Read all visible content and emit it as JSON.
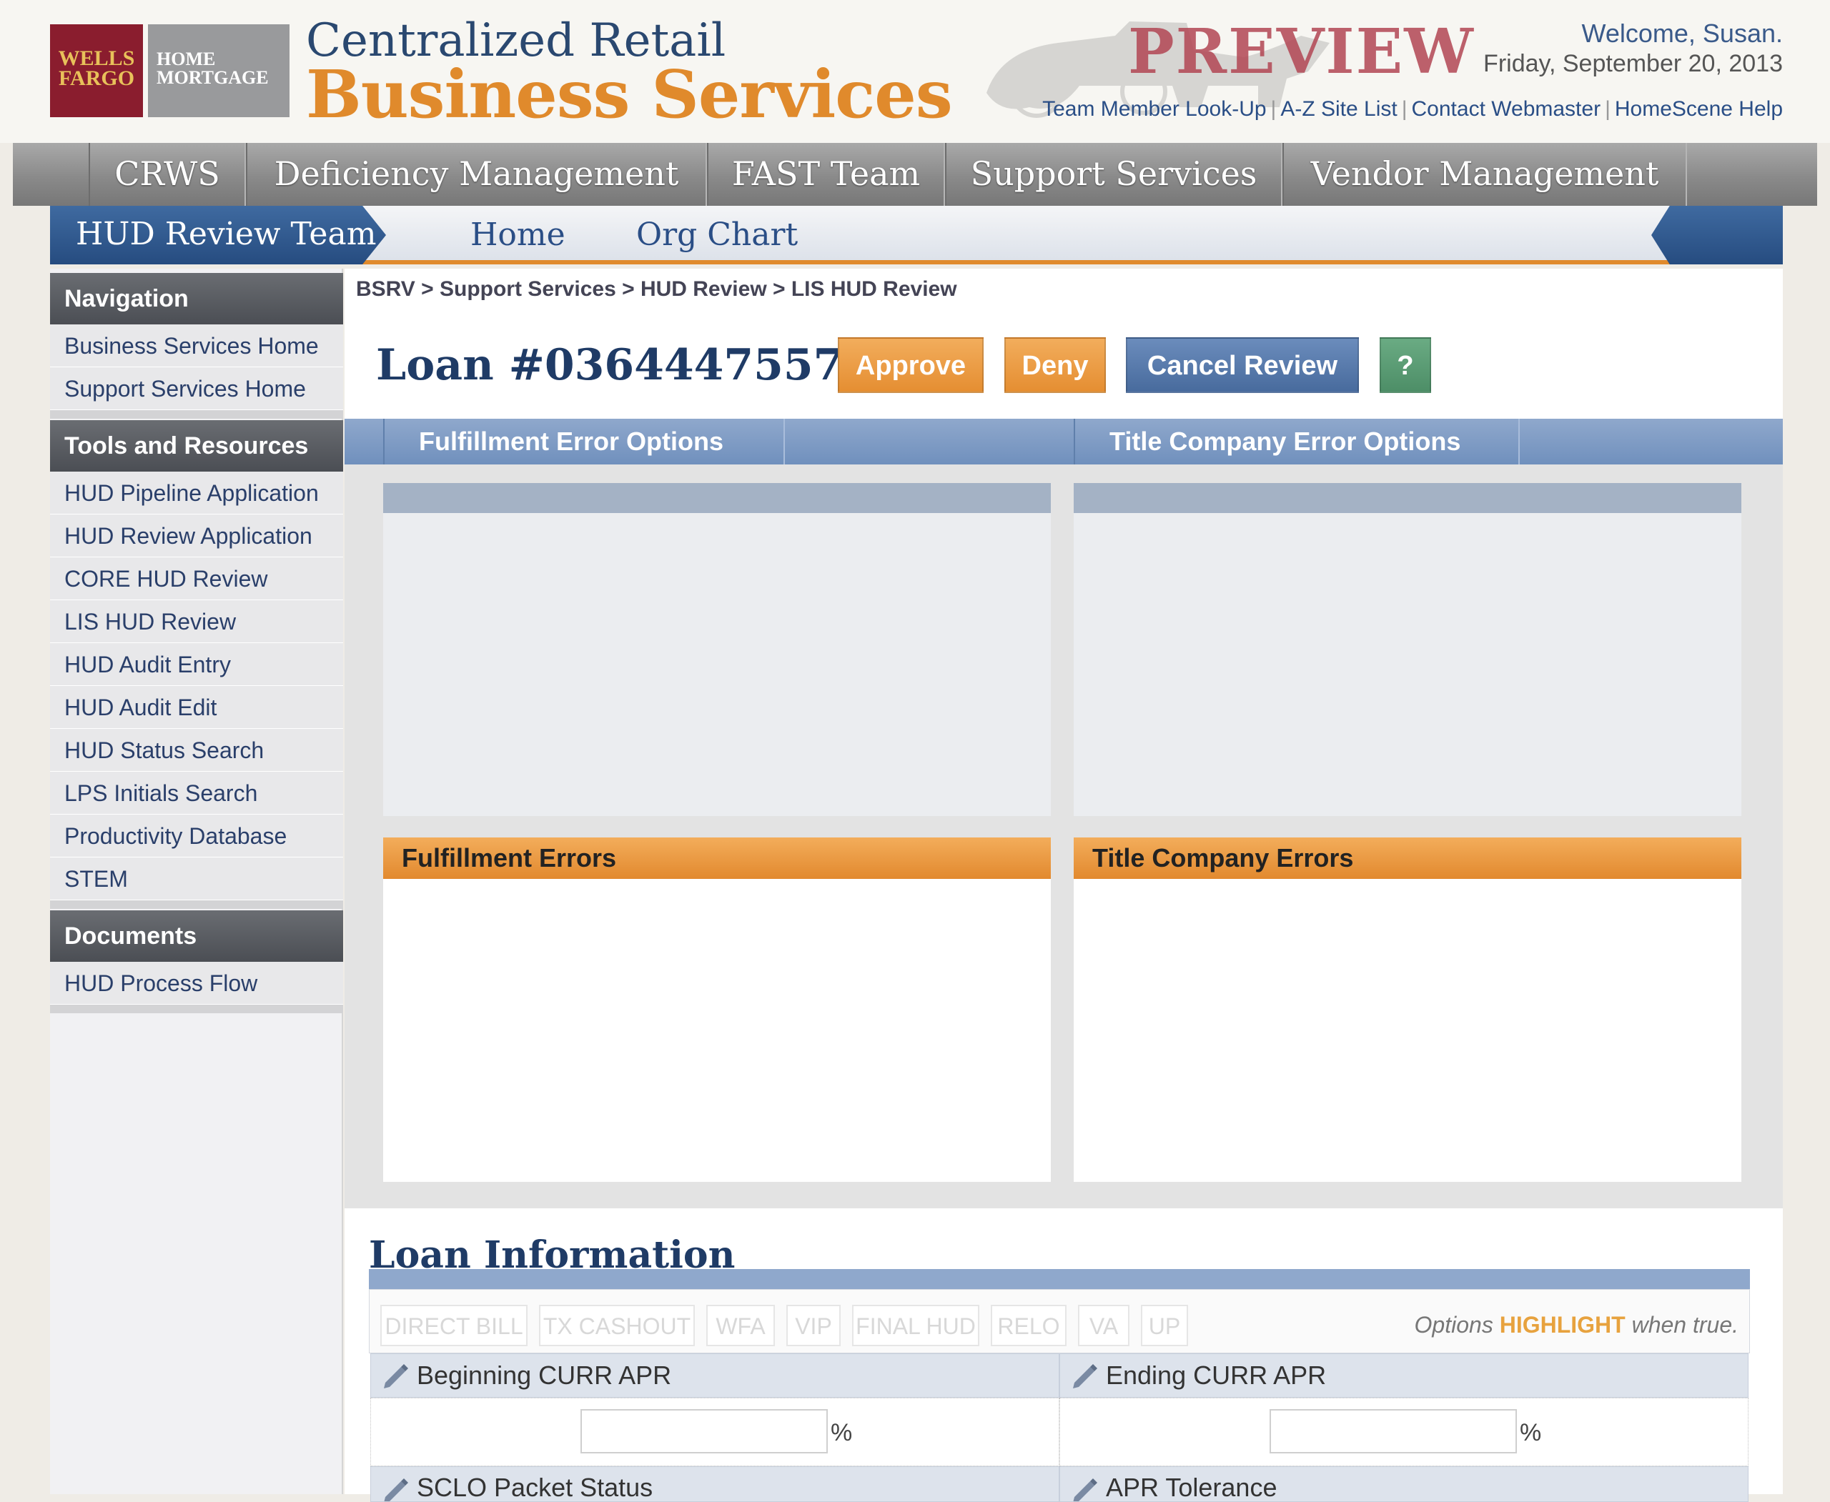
{
  "brand": {
    "logo_left": "WELLS FARGO",
    "logo_right": "HOME MORTGAGE",
    "title_line1": "Centralized Retail",
    "title_line2": "Business Services",
    "watermark": "PREVIEW"
  },
  "user": {
    "welcome": "Welcome, Susan.",
    "date": "Friday, September 20, 2013"
  },
  "top_links": [
    "Team Member Look-Up",
    "A-Z Site List",
    "Contact Webmaster",
    "HomeScene Help"
  ],
  "main_nav": [
    "CRWS",
    "Deficiency Management",
    "FAST Team",
    "Support Services",
    "Vendor Management"
  ],
  "sub_nav": {
    "active": "HUD Review Team",
    "links": [
      "Home",
      "Org Chart"
    ]
  },
  "sidebar": {
    "sections": [
      {
        "title": "Navigation",
        "items": [
          "Business Services Home",
          "Support Services Home"
        ]
      },
      {
        "title": "Tools and Resources",
        "items": [
          "HUD Pipeline Application",
          "HUD Review Application",
          "CORE HUD Review",
          "LIS HUD Review",
          "HUD Audit Entry",
          "HUD Audit Edit",
          "HUD Status Search",
          "LPS Initials Search",
          "Productivity Database",
          "STEM"
        ]
      },
      {
        "title": "Documents",
        "items": [
          "HUD Process Flow"
        ]
      }
    ]
  },
  "breadcrumb": "BSRV > Support Services > HUD Review > LIS HUD Review",
  "loan": {
    "title": "Loan #0364447557",
    "buttons": {
      "approve": "Approve",
      "deny": "Deny",
      "cancel": "Cancel Review",
      "help": "?"
    }
  },
  "error_options": {
    "tabs": [
      "Fulfillment Error Options",
      "Title Company Error Options"
    ],
    "fulfillment_errors_title": "Fulfillment Errors",
    "title_company_errors_title": "Title Company Errors"
  },
  "loan_information": {
    "title": "Loan Information",
    "options": [
      "DIRECT BILL",
      "TX CASHOUT",
      "WFA",
      "VIP",
      "FINAL HUD",
      "RELO",
      "VA",
      "UP"
    ],
    "note_prefix": "Options",
    "note_highlight": "HIGHLIGHT",
    "note_suffix": "when true.",
    "fields": [
      {
        "label": "Beginning CURR APR",
        "value": "",
        "unit": "%"
      },
      {
        "label": "Ending CURR APR",
        "value": "",
        "unit": "%"
      },
      {
        "label": "SCLO Packet Status",
        "value": ""
      },
      {
        "label": "APR Tolerance",
        "value": ""
      }
    ]
  },
  "colors": {
    "brand_red": "#8a1d2e",
    "accent_orange": "#e08a2c",
    "nav_blue": "#264c80",
    "link_blue": "#2a4e86",
    "help_green": "#4d8e67"
  }
}
